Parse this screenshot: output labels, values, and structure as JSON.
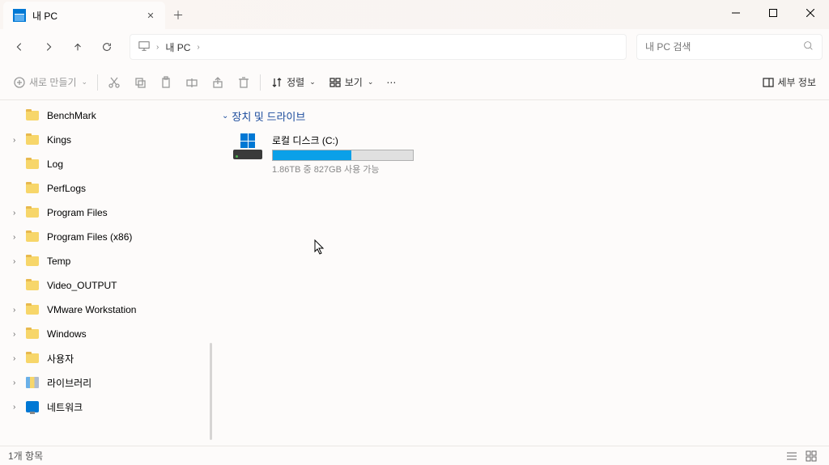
{
  "tab": {
    "title": "내 PC"
  },
  "address": {
    "location": "내 PC"
  },
  "search": {
    "placeholder": "내 PC 검색"
  },
  "toolbar": {
    "new": "새로 만들기",
    "sort": "정렬",
    "view": "보기",
    "details": "세부 정보"
  },
  "sidebar": {
    "items": [
      {
        "label": "BenchMark",
        "indent": 1,
        "expand": false,
        "icon": "folder"
      },
      {
        "label": "Kings",
        "indent": 1,
        "expand": true,
        "icon": "folder"
      },
      {
        "label": "Log",
        "indent": 1,
        "expand": false,
        "icon": "folder"
      },
      {
        "label": "PerfLogs",
        "indent": 1,
        "expand": false,
        "icon": "folder"
      },
      {
        "label": "Program Files",
        "indent": 1,
        "expand": true,
        "icon": "folder"
      },
      {
        "label": "Program Files (x86)",
        "indent": 1,
        "expand": true,
        "icon": "folder"
      },
      {
        "label": "Temp",
        "indent": 1,
        "expand": true,
        "icon": "folder"
      },
      {
        "label": "Video_OUTPUT",
        "indent": 1,
        "expand": false,
        "icon": "folder"
      },
      {
        "label": "VMware Workstation",
        "indent": 1,
        "expand": true,
        "icon": "folder"
      },
      {
        "label": "Windows",
        "indent": 1,
        "expand": true,
        "icon": "folder"
      },
      {
        "label": "사용자",
        "indent": 1,
        "expand": true,
        "icon": "folder"
      },
      {
        "label": "라이브러리",
        "indent": 0,
        "expand": true,
        "icon": "library"
      },
      {
        "label": "네트워크",
        "indent": 0,
        "expand": true,
        "icon": "network"
      }
    ]
  },
  "content": {
    "group_header": "장치 및 드라이브",
    "drive": {
      "name": "로컬 디스크 (C:)",
      "stats": "1.86TB 중 827GB 사용 가능",
      "fill_percent": 56
    }
  },
  "status": {
    "count": "1개 항목"
  }
}
